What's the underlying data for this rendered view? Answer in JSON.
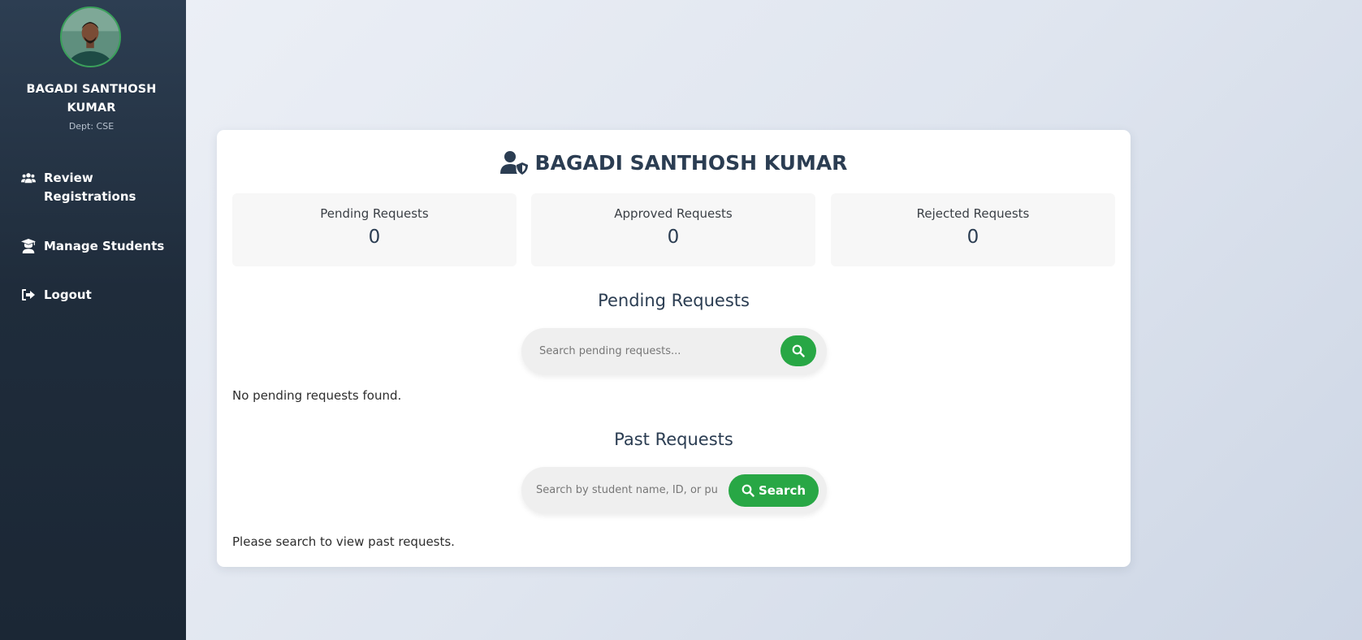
{
  "sidebar": {
    "profile": {
      "name": "BAGADI SANTHOSH KUMAR",
      "dept": "Dept: CSE"
    },
    "nav": [
      {
        "label": "Review Registrations",
        "icon": "users-icon"
      },
      {
        "label": "Manage Students",
        "icon": "graduate-icon"
      },
      {
        "label": "Logout",
        "icon": "logout-icon"
      }
    ]
  },
  "main": {
    "title": "BAGADI SANTHOSH KUMAR",
    "title_icon": "user-shield-icon",
    "stats": [
      {
        "label": "Pending Requests",
        "value": "0"
      },
      {
        "label": "Approved Requests",
        "value": "0"
      },
      {
        "label": "Rejected Requests",
        "value": "0"
      }
    ],
    "pending": {
      "title": "Pending Requests",
      "search_placeholder": "Search pending requests...",
      "empty_message": "No pending requests found."
    },
    "past": {
      "title": "Past Requests",
      "search_placeholder": "Search by student name, ID, or purpose...",
      "search_button": "Search",
      "empty_message": "Please search to view past requests."
    }
  },
  "colors": {
    "accent_green": "#28a745",
    "sidebar_dark": "#1f2c3b",
    "title_text": "#2b3d52"
  }
}
